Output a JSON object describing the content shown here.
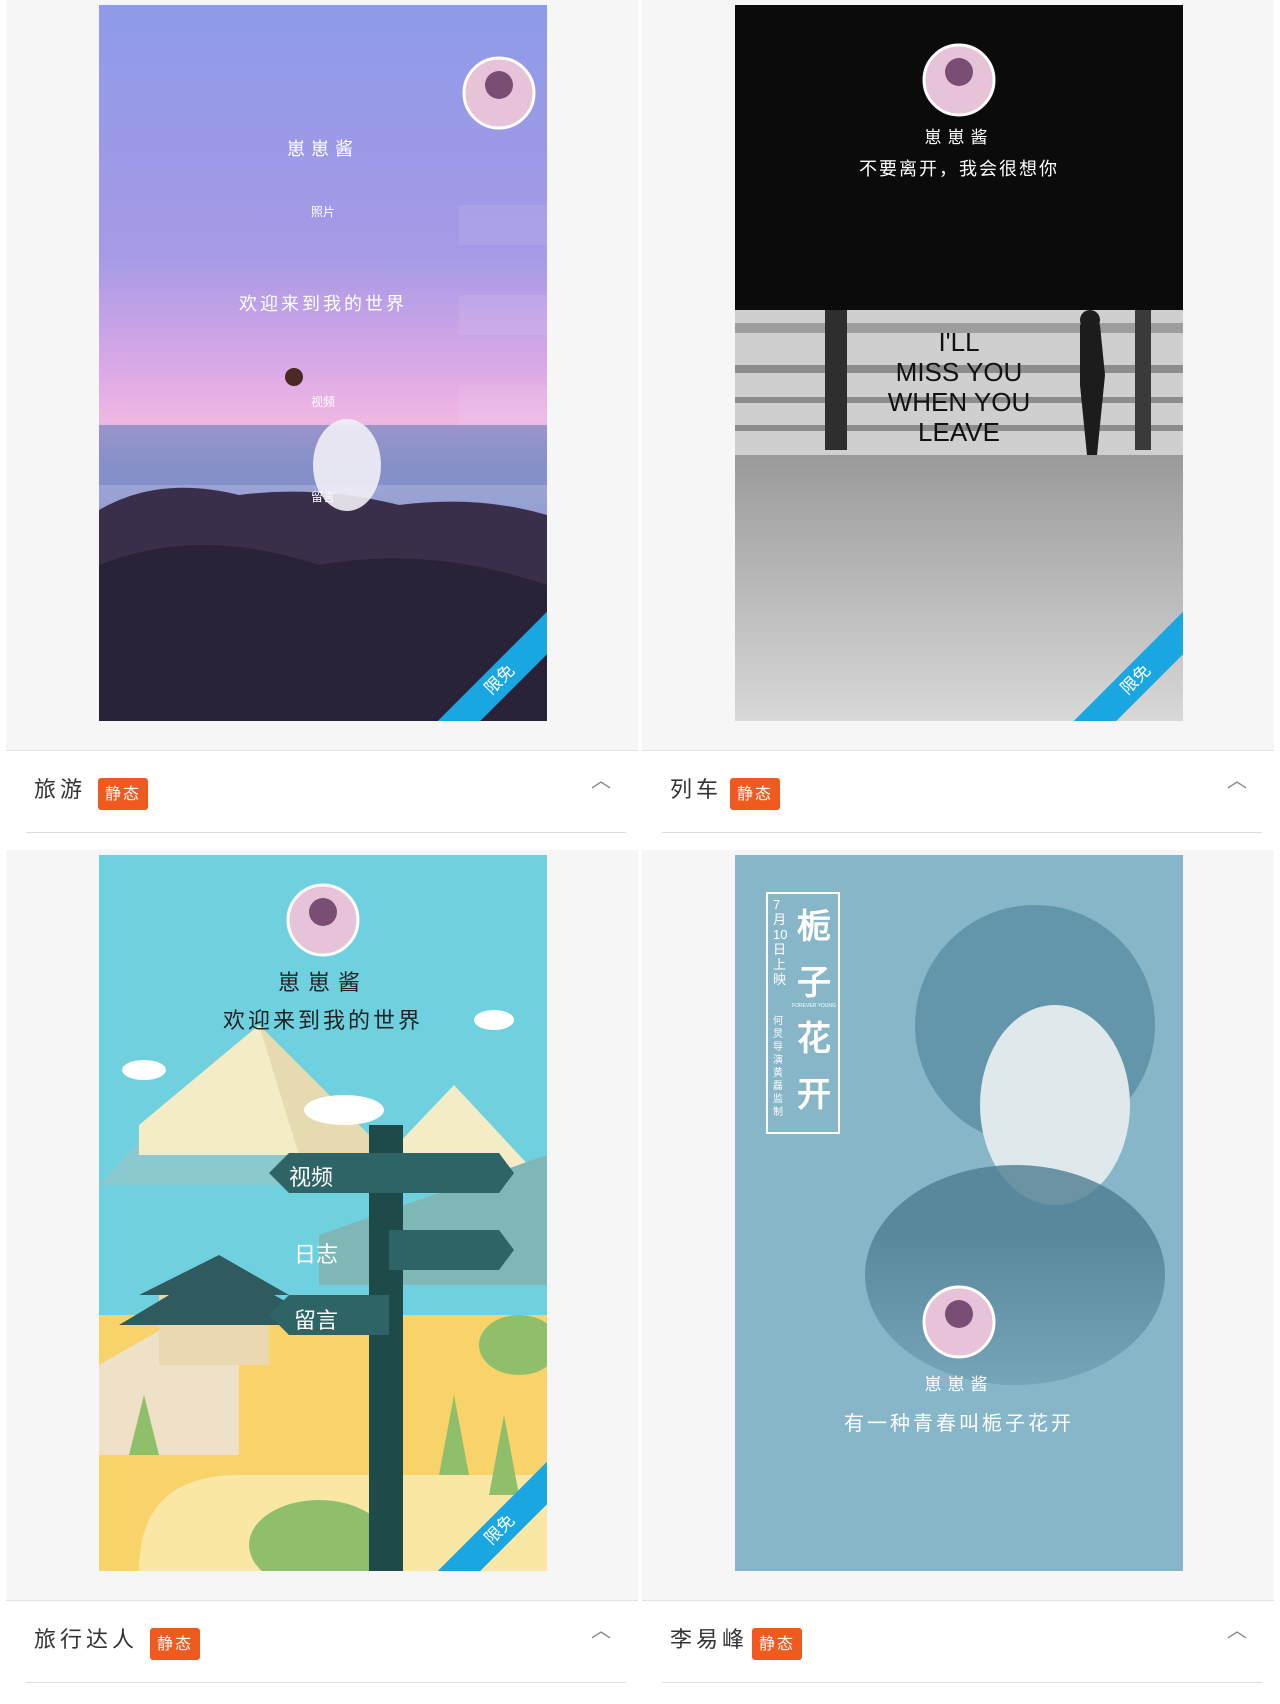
{
  "cards": [
    {
      "name": "旅游",
      "badge": "静态",
      "ribbon": "限免",
      "art": {
        "username": "崽崽酱",
        "menu1": "照片",
        "welcome": "欢迎来到我的世界",
        "menu2": "视频",
        "menu3": "留言"
      }
    },
    {
      "name": "列车",
      "badge": "静态",
      "ribbon": "限免",
      "art": {
        "username": "崽崽酱",
        "subtitle": "不要离开，我会很想你",
        "poster_lines": [
          "I'LL",
          "MISS YOU",
          "WHEN YOU",
          "LEAVE"
        ]
      }
    },
    {
      "name": "旅行达人",
      "badge": "静态",
      "ribbon": "限免",
      "art": {
        "username": "崽崽酱",
        "welcome": "欢迎来到我的世界",
        "sign1": "视频",
        "sign2": "日志",
        "sign3": "留言"
      }
    },
    {
      "name": "李易峰",
      "badge": "静态",
      "art": {
        "username": "崽崽酱",
        "poster_date": "7月10日上映",
        "poster_names": "何炅 导演 黄磊 监制",
        "poster_title": "栀子花开",
        "poster_en": "FOREVER YOUNG",
        "subtitle": "有一种青春叫栀子花开"
      }
    }
  ],
  "colors": {
    "badge": "#f15a1e",
    "ribbon": "#1aa6e0",
    "card_bg": "#f6f6f6"
  },
  "icons": {
    "collapse": "chevron-up-icon"
  }
}
